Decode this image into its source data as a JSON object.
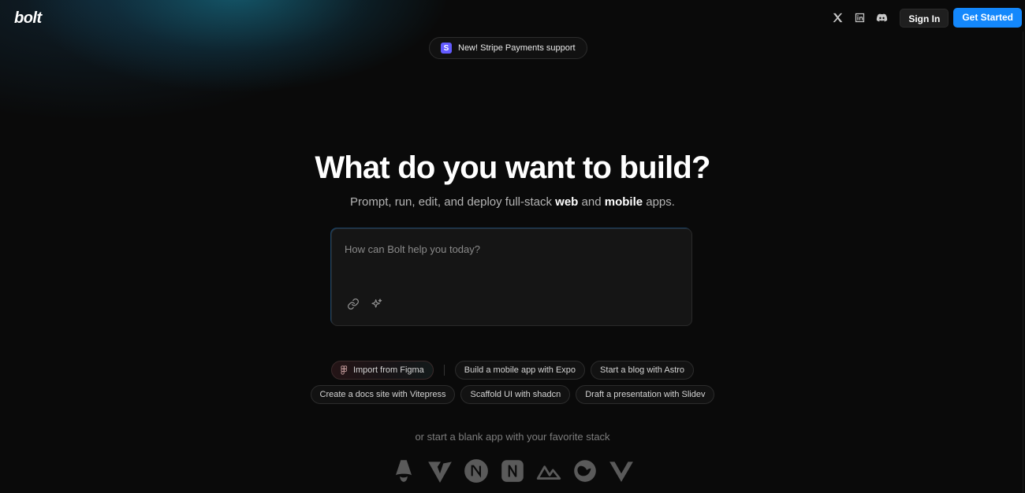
{
  "header": {
    "logo": "bolt",
    "social": [
      {
        "name": "x-icon"
      },
      {
        "name": "linkedin-icon"
      },
      {
        "name": "discord-icon"
      }
    ],
    "sign_in": "Sign In",
    "get_started": "Get Started"
  },
  "announcement": {
    "badge": "S",
    "text": "New! Stripe Payments support"
  },
  "hero": {
    "title": "What do you want to build?",
    "sub_prefix": "Prompt, run, edit, and deploy full-stack ",
    "sub_web": "web",
    "sub_and": " and ",
    "sub_mobile": "mobile",
    "sub_suffix": " apps."
  },
  "prompt": {
    "placeholder": "How can Bolt help you today?",
    "tools": [
      "link-icon",
      "sparkle-icon"
    ]
  },
  "suggestions": {
    "figma": "Import from Figma",
    "row1": [
      "Build a mobile app with Expo",
      "Start a blog with Astro"
    ],
    "row2": [
      "Create a docs site with Vitepress",
      "Scaffold UI with shadcn",
      "Draft a presentation with Slidev"
    ]
  },
  "blank": {
    "text": "or start a blank app with your favorite stack",
    "stacks": [
      "astro-icon",
      "vite-icon",
      "next-icon",
      "nuxt-icon",
      "nuxt-alt-icon",
      "remix-icon",
      "vue-icon"
    ]
  },
  "colors": {
    "background": "#0a0a0a",
    "accent": "#1488fc",
    "stripe": "#635bff"
  }
}
